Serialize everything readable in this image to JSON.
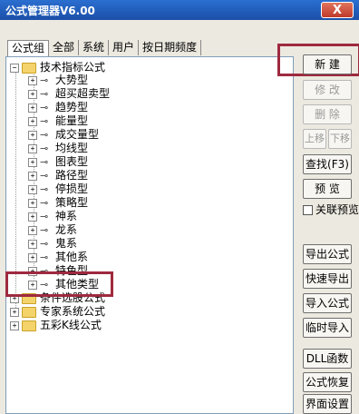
{
  "window": {
    "title": "公式管理器V6.00",
    "close_label": "X"
  },
  "tabs": [
    "公式组",
    "全部",
    "系统",
    "用户",
    "按日期频度"
  ],
  "tree": {
    "root": "技术指标公式",
    "children": [
      "大势型",
      "超买超卖型",
      "趋势型",
      "能量型",
      "成交量型",
      "均线型",
      "图表型",
      "路径型",
      "停损型",
      "策略型",
      "神系",
      "龙系",
      "鬼系",
      "其他系",
      "特色型",
      "其他类型"
    ],
    "groups": [
      "条件选股公式",
      "专家系统公式",
      "五彩K线公式"
    ]
  },
  "buttons": {
    "new": "新 建",
    "edit": "修 改",
    "delete": "删 除",
    "move_up": "上移",
    "move_down": "下移",
    "find": "查找(F3)",
    "preview": "预 览",
    "linked_preview": "关联预览",
    "export": "导出公式",
    "quick_export": "快速导出",
    "import": "导入公式",
    "temp_import": "临时导入",
    "dll": "DLL函数",
    "restore": "公式恢复",
    "ui_settings": "界面设置"
  },
  "colors": {
    "highlight": "#9e2a3f",
    "titlebar": "#2a6fd0"
  }
}
